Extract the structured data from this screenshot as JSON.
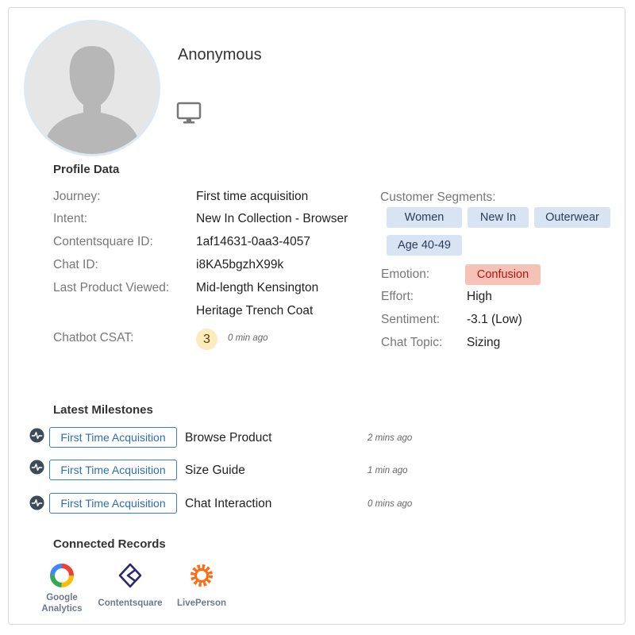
{
  "profile": {
    "name": "Anonymous",
    "device_icon": "monitor-icon"
  },
  "profile_data": {
    "title": "Profile Data",
    "fields": [
      {
        "label": "Journey:",
        "value": "First time acquisition"
      },
      {
        "label": "Intent:",
        "value": "New In Collection - Browser"
      },
      {
        "label": "Contentsquare ID:",
        "value": "1af14631-0aa3-4057"
      },
      {
        "label": "Chat ID:",
        "value": "i8KA5bgzhX99k"
      },
      {
        "label": "Last Product Viewed:",
        "value": "Mid-length Kensington",
        "value2": "Heritage Trench Coat"
      }
    ],
    "csat": {
      "label": "Chatbot CSAT:",
      "score": "3",
      "time": "0 min ago"
    }
  },
  "segments": {
    "label": "Customer Segments:",
    "tags": [
      "Women",
      "New In",
      "Outerwear",
      "Age 40-49"
    ]
  },
  "metrics": {
    "emotion": {
      "label": "Emotion:",
      "value": "Confusion"
    },
    "effort": {
      "label": "Effort:",
      "value": "High"
    },
    "sentiment": {
      "label": "Sentiment:",
      "value": "-3.1 (Low)"
    },
    "topic": {
      "label": "Chat Topic:",
      "value": "Sizing"
    }
  },
  "milestones": {
    "title": "Latest Milestones",
    "items": [
      {
        "icon": "activity-icon",
        "tag": "First Time Acquisition",
        "event": "Browse Product",
        "time": "2 mins ago"
      },
      {
        "icon": "activity-icon",
        "tag": "First Time Acquisition",
        "event": "Size Guide",
        "time": "1 min ago"
      },
      {
        "icon": "activity-icon",
        "tag": "First Time Acquisition",
        "event": "Chat Interaction",
        "time": "0 mins ago"
      }
    ]
  },
  "connected_records": {
    "title": "Connected Records",
    "items": [
      {
        "icon": "google-analytics-logo",
        "line1": "Google",
        "line2": "Analytics"
      },
      {
        "icon": "contentsquare-logo",
        "line1": "Contentsquare"
      },
      {
        "icon": "liveperson-logo",
        "line1": "LivePerson"
      }
    ]
  },
  "colors": {
    "chip_bg": "#d8e3f3",
    "emotion_bg": "#f6c2b7",
    "emotion_text": "#b3150d",
    "milestone_border": "#3b7cc4",
    "csat_bg": "#fcebbd"
  }
}
